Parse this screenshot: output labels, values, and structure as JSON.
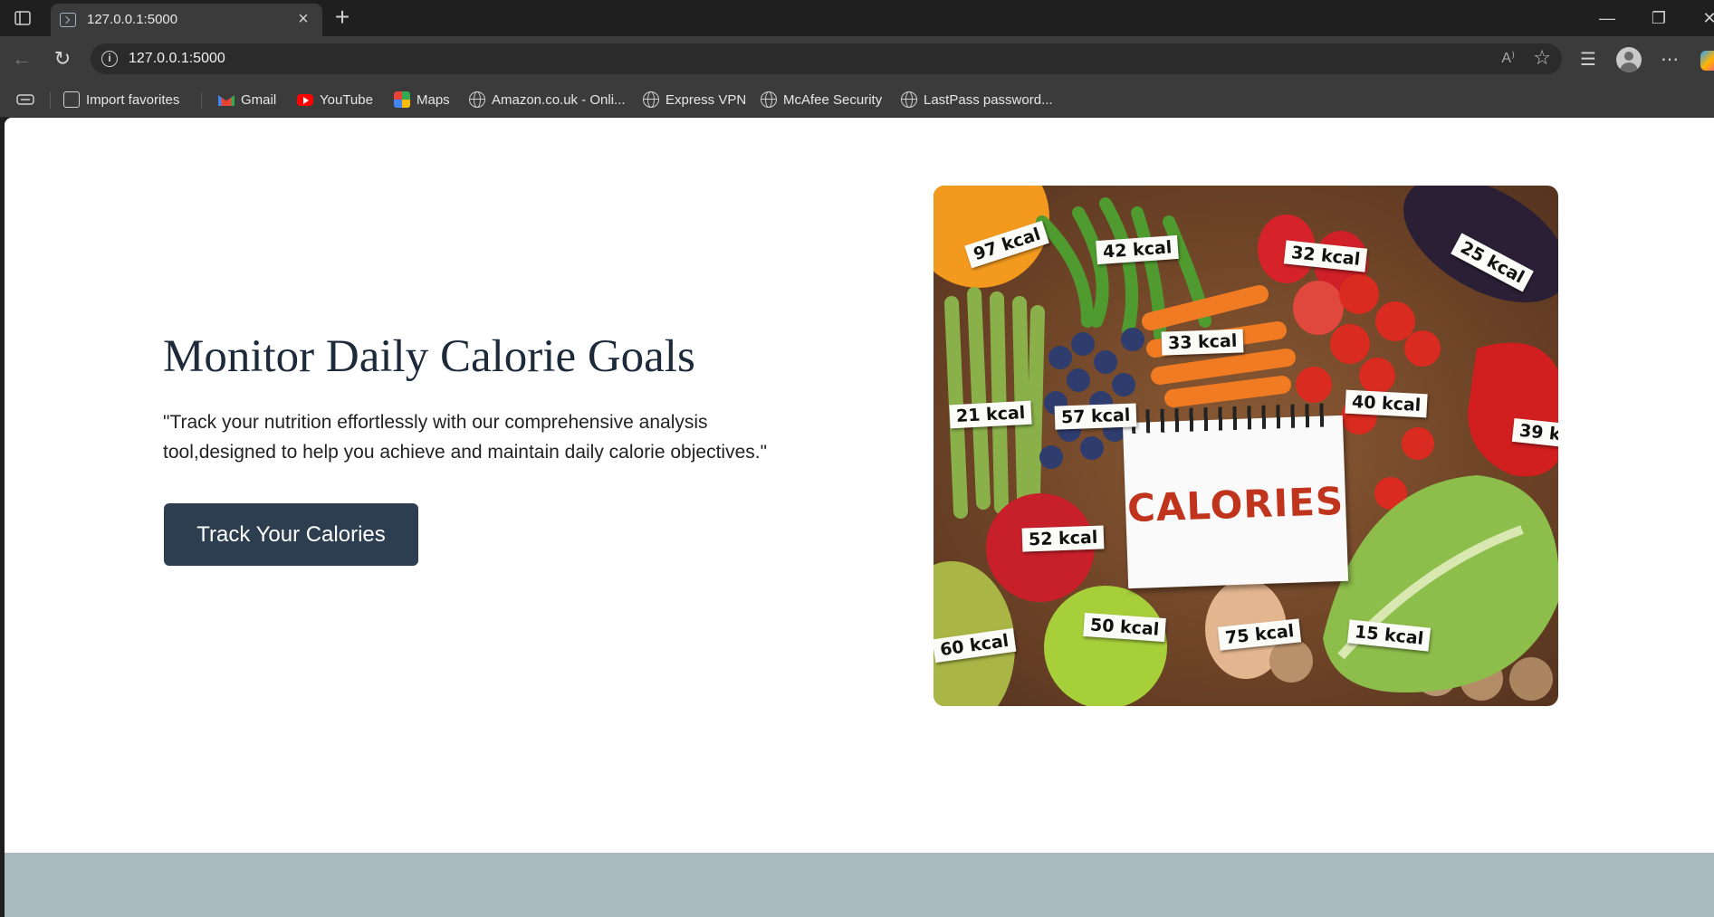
{
  "browser": {
    "tab_title": "127.0.0.1:5000",
    "url": "127.0.0.1:5000",
    "read_aloud_glyph": "A⁾",
    "bookmarks": [
      {
        "label": "Import favorites",
        "icon": "import-icon"
      },
      {
        "label": "Gmail",
        "icon": "gmail-icon"
      },
      {
        "label": "YouTube",
        "icon": "youtube-icon"
      },
      {
        "label": "Maps",
        "icon": "maps-icon"
      },
      {
        "label": "Amazon.co.uk - Onli...",
        "icon": "globe-icon"
      },
      {
        "label": "Express VPN",
        "icon": "globe-icon"
      },
      {
        "label": "McAfee Security",
        "icon": "globe-icon"
      },
      {
        "label": "LastPass password...",
        "icon": "globe-icon"
      }
    ]
  },
  "hero": {
    "title": "Monitor Daily Calorie Goals",
    "description": "\"Track your nutrition effortlessly with our comprehensive analysis tool,designed to help you achieve and maintain daily calorie objectives.\"",
    "cta_label": "Track Your Calories"
  },
  "image": {
    "center_word": "CALORIES",
    "labels": [
      "97 kcal",
      "42 kcal",
      "32 kcal",
      "25 kcal",
      "33 kcal",
      "21 kcal",
      "57 kcal",
      "40 kcal",
      "39 k",
      "52 kcal",
      "60 kcal",
      "50 kcal",
      "75 kcal",
      "15 kcal"
    ]
  },
  "colors": {
    "cta_background": "#2c3e50",
    "footer_band": "#a8babd",
    "browser_chrome": "#3b3b3b"
  }
}
